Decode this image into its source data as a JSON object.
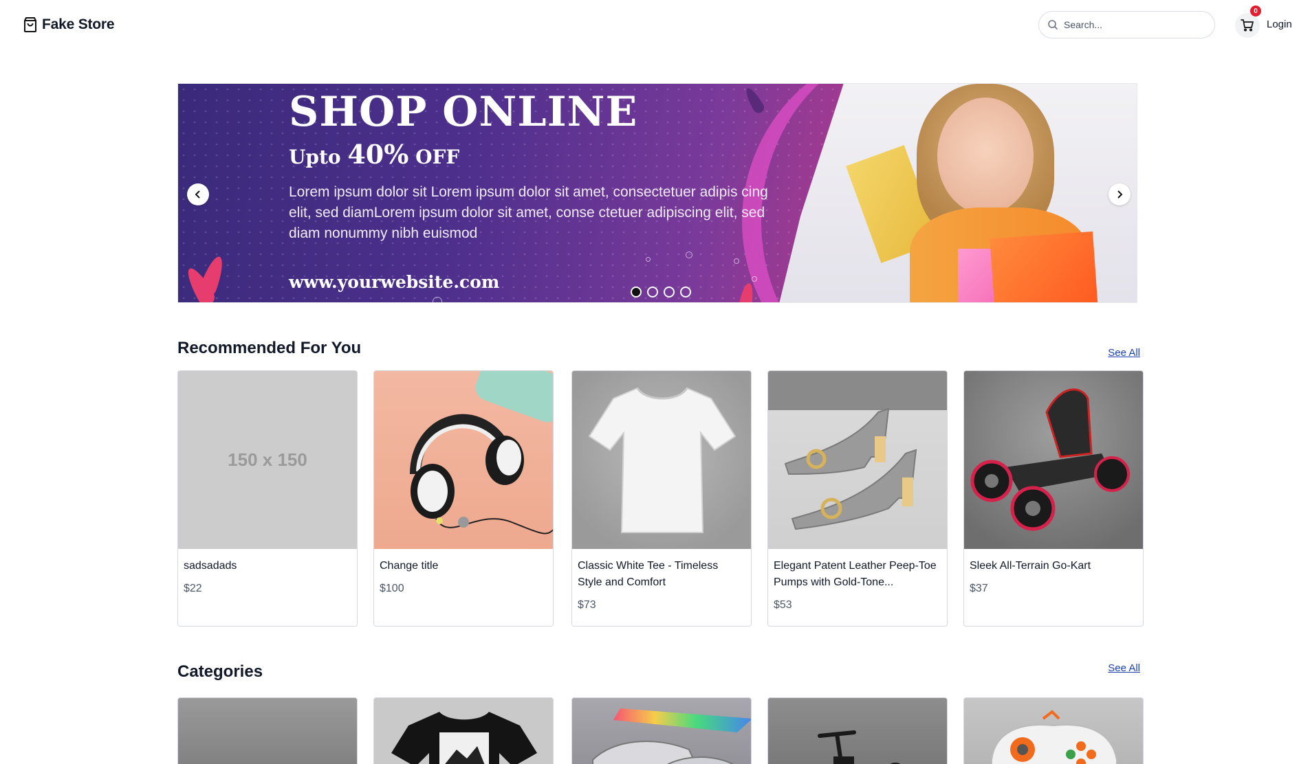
{
  "header": {
    "brand": "Fake Store",
    "search_placeholder": "Search...",
    "cart_count": "0",
    "login_label": "Login"
  },
  "banner": {
    "title": "SHOP ONLINE",
    "subtitle_prefix": "Upto ",
    "subtitle_highlight": "40%",
    "subtitle_suffix": " OFF",
    "body": "Lorem ipsum dolor sit Lorem ipsum dolor sit amet, consectetuer adipis cing elit, sed diamLorem ipsum dolor sit amet, conse ctetuer adipiscing elit, sed diam nonummy nibh euismod",
    "url": "www.yourwebsite.com",
    "slide_count": 4,
    "active_slide": 1
  },
  "recommended": {
    "title": "Recommended For You",
    "see_all": "See All",
    "products": [
      {
        "name": "sadsadads",
        "price": "$22",
        "image": "placeholder-150x150",
        "placeholder_text": "150 x 150"
      },
      {
        "name": "Change title",
        "price": "$100",
        "image": "headphones"
      },
      {
        "name": "Classic White Tee - Timeless Style and Comfort",
        "price": "$73",
        "image": "white-tshirt"
      },
      {
        "name": "Elegant Patent Leather Peep-Toe Pumps with Gold-Tone...",
        "price": "$53",
        "image": "peep-toe-pumps"
      },
      {
        "name": "Sleek All-Terrain Go-Kart",
        "price": "$37",
        "image": "go-kart"
      }
    ]
  },
  "categories": {
    "title": "Categories",
    "see_all": "See All",
    "items": [
      {
        "image": "gray-backdrop"
      },
      {
        "image": "black-tshirt"
      },
      {
        "image": "silver-sneakers"
      },
      {
        "image": "scooter"
      },
      {
        "image": "game-controller"
      }
    ]
  },
  "colors": {
    "badge": "#e11d2e",
    "link": "#1d3fb0",
    "banner_start": "#3a2a7a",
    "banner_end": "#b03a8c"
  }
}
